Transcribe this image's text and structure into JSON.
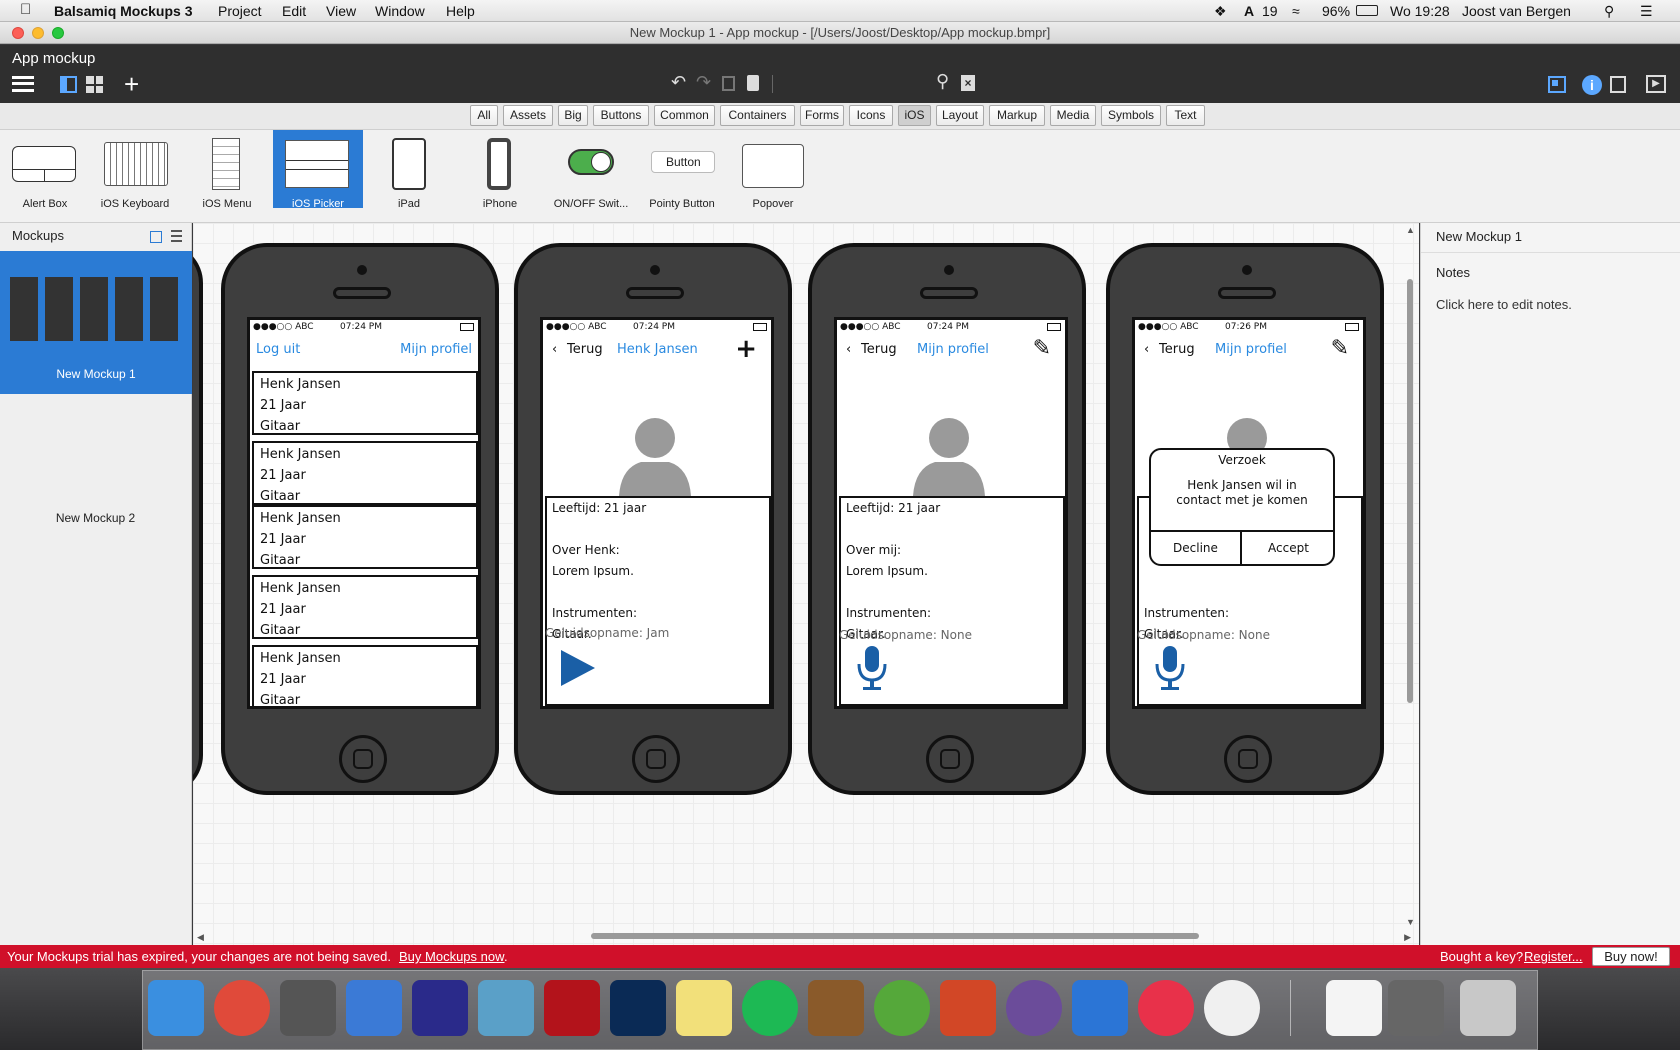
{
  "menubar": {
    "app_name": "Balsamiq Mockups 3",
    "items": [
      "Project",
      "Edit",
      "View",
      "Window",
      "Help"
    ],
    "status_number": "19",
    "battery": "96%",
    "clock": "Wo 19:28",
    "user": "Joost van Bergen"
  },
  "window": {
    "title": "New Mockup 1 - App mockup - [/Users/Joost/Desktop/App mockup.bmpr]"
  },
  "appbar": {
    "project_name": "App mockup"
  },
  "filters": [
    "All",
    "Assets",
    "Big",
    "Buttons",
    "Common",
    "Containers",
    "Forms",
    "Icons",
    "iOS",
    "Layout",
    "Markup",
    "Media",
    "Symbols",
    "Text"
  ],
  "filter_active": "iOS",
  "library": {
    "items": [
      "Alert Box",
      "iOS Keyboard",
      "iOS Menu",
      "iOS Picker",
      "iPad",
      "iPhone",
      "ON/OFF Swit...",
      "Pointy Button",
      "Popover"
    ],
    "selected": "iOS Picker",
    "pointy_button_text": "Button"
  },
  "sidebar": {
    "header": "Mockups",
    "mockups": [
      "New Mockup 1",
      "New Mockup 2"
    ],
    "selected": "New Mockup 1"
  },
  "inspector": {
    "title": "New Mockup 1",
    "notes_label": "Notes",
    "notes_placeholder": "Click here to edit notes."
  },
  "phones": {
    "status_carrier": "●●●○○ ABC",
    "phone1": {
      "time": "07:24 PM",
      "nav_left": "Log uit",
      "nav_right": "Mijn profiel",
      "cards": [
        [
          "Henk Jansen",
          "21 Jaar",
          "Gitaar"
        ],
        [
          "Henk Jansen",
          "21 Jaar",
          "Gitaar"
        ],
        [
          "Henk Jansen",
          "21 Jaar",
          "Gitaar"
        ],
        [
          "Henk Jansen",
          "21 Jaar",
          "Gitaar"
        ],
        [
          "Henk Jansen",
          "21 Jaar",
          "Gitaar"
        ]
      ]
    },
    "phone2": {
      "time": "07:24 PM",
      "back": "Terug",
      "title": "Henk Jansen",
      "lines": [
        "Leeftijd: 21 jaar",
        "",
        "Over Henk:",
        "Lorem Ipsum.",
        "",
        "Instrumenten:",
        "Gitaar."
      ],
      "recording": "Geluidsopname: Jam"
    },
    "phone3": {
      "time": "07:24 PM",
      "back": "Terug",
      "title": "Mijn profiel",
      "lines": [
        "Leeftijd: 21 jaar",
        "",
        "Over mij:",
        "Lorem Ipsum.",
        "",
        "Instrumenten:",
        "Gitaar."
      ],
      "recording": "Geluidsopname: None"
    },
    "phone4": {
      "time": "07:26 PM",
      "back": "Terug",
      "title": "Mijn profiel",
      "lines": [
        "Instrumenten:",
        "Gitaar."
      ],
      "recording": "Geluidsopname: None",
      "alert": {
        "title": "Verzoek",
        "message": "Henk Jansen wil in contact met je komen",
        "decline": "Decline",
        "accept": "Accept"
      }
    }
  },
  "trial": {
    "message": "Your Mockups trial has expired, your changes are not being saved.",
    "link": "Buy Mockups now",
    "key_text": "Bought a key?",
    "register": "Register...",
    "buy_button": "Buy now!"
  },
  "dock": {
    "apps": [
      "finder-icon",
      "chrome-icon",
      "sublime-icon",
      "xcode-icon",
      "audacity-icon",
      "maps-icon",
      "filezilla-icon",
      "photoshop-icon",
      "notes-icon",
      "spotify-icon",
      "guitar-icon",
      "utorrent-icon",
      "powerpoint-icon",
      "github-icon",
      "word-icon",
      "itunes-icon",
      "face-icon",
      "document-icon",
      "screenshot-icon",
      "trash-icon"
    ]
  },
  "colors": {
    "accent_blue": "#2b7bd4",
    "ios_link_blue": "#2a8ae0",
    "trial_red": "#d0102a",
    "toolbar_dark": "#2f2f2f"
  }
}
